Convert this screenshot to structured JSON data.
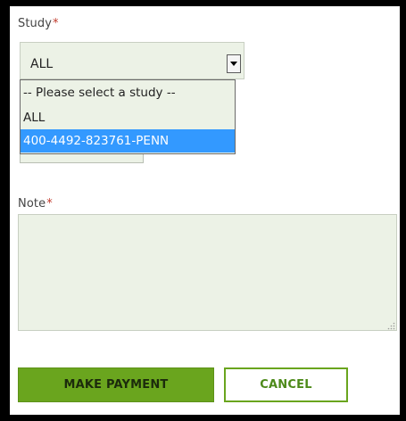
{
  "form": {
    "study": {
      "label": "Study",
      "required_mark": "*",
      "selected_value": "ALL",
      "options": [
        "-- Please select a study --",
        "ALL",
        "400-4492-823761-PENN"
      ],
      "highlighted_index": 2
    },
    "note": {
      "label": "Note",
      "required_mark": "*",
      "value": ""
    }
  },
  "actions": {
    "make_payment_label": "MAKE PAYMENT",
    "cancel_label": "CANCEL"
  },
  "colors": {
    "accent_green": "#6aa51e",
    "field_bg": "#ecf2e6",
    "highlight_blue": "#3399ff",
    "required_red": "#c0392b"
  }
}
